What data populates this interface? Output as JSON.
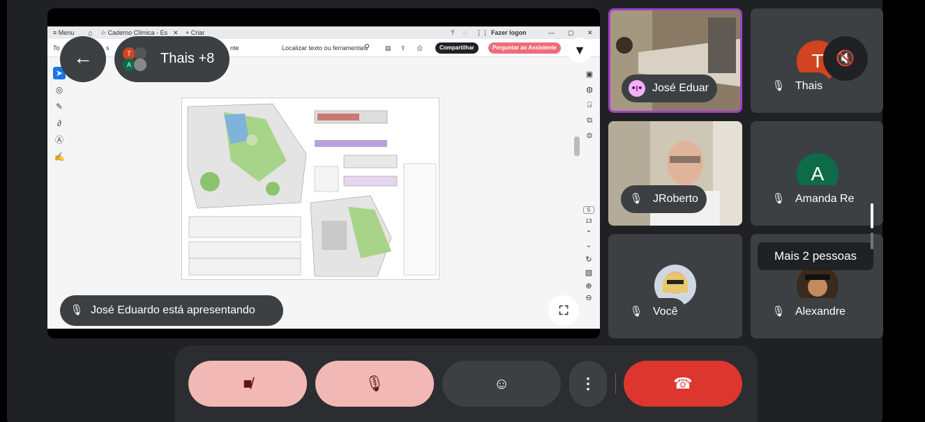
{
  "app": {
    "presenting_text": "José Eduardo está apresentando",
    "people_chip_label": "Thais +8",
    "back_icon": "arrow-left-icon",
    "fullscreen_icon": "fullscreen-icon",
    "pin_icon": "pin-icon"
  },
  "shared_browser": {
    "menu_label": "≡ Menu",
    "tab_title": "☆ Caderno Clímica - Es",
    "new_tab": "+ Criar",
    "signin_label": "Fazer logon",
    "window_controls": [
      "—",
      "▢",
      "✕"
    ],
    "toolbar_left": "To",
    "toolbar_left2": "s",
    "toolbar_left3": "nte",
    "search_tools_label": "Localizar texto ou ferramentas",
    "share_button": "Compartilhar",
    "assistant_button": "Perguntar ao Assistente",
    "page_current": "5",
    "page_total": "13"
  },
  "participants": [
    {
      "name": "José Eduar",
      "state": "speaking"
    },
    {
      "name": "Thais",
      "state": "muted",
      "avatar_letter": "T"
    },
    {
      "name": "JRoberto",
      "state": "muted"
    },
    {
      "name": "Amanda Re",
      "state": "muted",
      "avatar_letter": "A"
    },
    {
      "name": "Você",
      "state": "muted"
    },
    {
      "name": "Alexandre",
      "state": "muted"
    }
  ],
  "more_people_label": "Mais 2 pessoas",
  "colors": {
    "speaking_border": "#a142c9",
    "muted_button_bg": "#f2b8b5",
    "hangup_bg": "#dc362e",
    "thais_avatar": "#d1441f",
    "amanda_avatar": "#0e6b4a",
    "share_btn": "#202124",
    "assistant_btn": "#f06c7a"
  },
  "controls": [
    {
      "name": "camera-off",
      "icon": "video-off-icon"
    },
    {
      "name": "mic-off",
      "icon": "mic-off-icon"
    },
    {
      "name": "reactions",
      "icon": "smile-icon"
    },
    {
      "name": "more-options",
      "icon": "more-vertical-icon"
    },
    {
      "name": "hang-up",
      "icon": "phone-hangup-icon"
    }
  ]
}
